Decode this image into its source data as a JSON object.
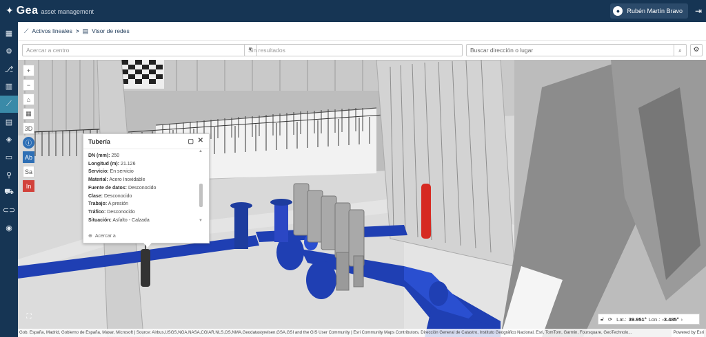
{
  "app": {
    "logo_text": "Gea",
    "logo_subtitle": "asset management",
    "user_name": "Rubén Martín Bravo"
  },
  "breadcrumb": {
    "first": "Activos lineales",
    "separator": ">",
    "second": "Visor de redes"
  },
  "search": {
    "center_placeholder": "Acercar a centro",
    "results_text": "Sin resultados",
    "address_placeholder": "Buscar dirección o lugar"
  },
  "map_tools": {
    "zoom_in": "+",
    "zoom_out": "−",
    "mode_3d": "3D",
    "btn_ab": "Ab",
    "btn_sa": "Sa",
    "btn_in": "In"
  },
  "popup": {
    "title": "Tubería",
    "attributes": [
      {
        "label": "DN (mm):",
        "value": "250"
      },
      {
        "label": "Longitud (m):",
        "value": "21.126"
      },
      {
        "label": "Servicio:",
        "value": "En servicio"
      },
      {
        "label": "Material:",
        "value": "Acero Inoxidable"
      },
      {
        "label": "Fuente de datos:",
        "value": "Desconocido"
      },
      {
        "label": "Clase:",
        "value": "Desconocido"
      },
      {
        "label": "Trabajo:",
        "value": "A presión"
      },
      {
        "label": "Tráfico:",
        "value": "Desconocido"
      },
      {
        "label": "Situación:",
        "value": "Asfalto - Calzada"
      }
    ],
    "zoom_to": "Acercar a"
  },
  "coords": {
    "lat_label": "Lat.:",
    "lat_value": "39.951°",
    "lon_label": "Lon.:",
    "lon_value": "-3.485°"
  },
  "attribution": {
    "text": "Gob. España, Madrid, Gobierno de España, Maxar, Microsoft | Source: Airbus,USGS,NGA,NASA,CGIAR,NLS,OS,NMA,Geodatastyrelsen,GSA,GSI and the GIS User Community | Esri Community Maps Contributors, Dirección General de Catastro, Instituto Geográfico Nacional, Esri, TomTom, Garmin, Foursquare, GeoTechnolo...",
    "powered": "Powered by Esri"
  },
  "colors": {
    "topbar": "#163554",
    "sidebar_active": "#3a8aa8",
    "pipe_blue": "#1f3fb3",
    "valve_red": "#d62a22"
  },
  "icons": {
    "sidebar": [
      "dashboard-icon",
      "gear-icon",
      "network-icon",
      "building-icon",
      "line-asset-icon",
      "calendar-icon",
      "box-icon",
      "document-icon",
      "pin-icon",
      "car-icon",
      "link-icon",
      "location-icon"
    ]
  }
}
